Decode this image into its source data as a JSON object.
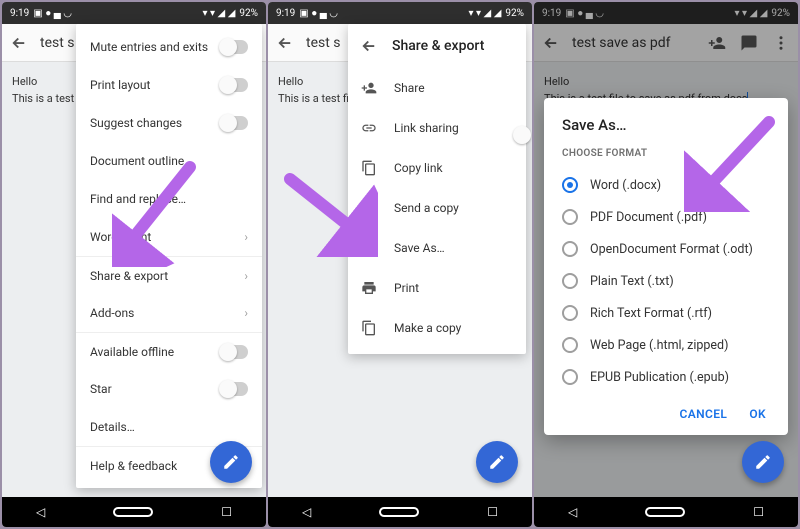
{
  "status": {
    "time": "9:19",
    "battery": "92%"
  },
  "doc": {
    "title_short": "test s",
    "title_full": "test save as pdf",
    "line1": "Hello",
    "line2_short": "This is a test fi",
    "line2_full": "This is a test file to save as pdf from docs"
  },
  "menu_items": [
    {
      "label": "Mute entries and exits",
      "type": "toggle"
    },
    {
      "label": "Print layout",
      "type": "toggle"
    },
    {
      "label": "Suggest changes",
      "type": "toggle"
    },
    {
      "label": "Document outline",
      "type": "plain"
    },
    {
      "label": "Find and replace…",
      "type": "plain"
    },
    {
      "label": "Word count",
      "type": "chevron"
    },
    {
      "label": "Share & export",
      "type": "chevron",
      "sep": true
    },
    {
      "label": "Add-ons",
      "type": "chevron"
    },
    {
      "label": "Available offline",
      "type": "toggle",
      "sep": true
    },
    {
      "label": "Star",
      "type": "toggle"
    },
    {
      "label": "Details…",
      "type": "plain"
    },
    {
      "label": "Help & feedback",
      "type": "plain",
      "sep": true
    }
  ],
  "share_panel": {
    "title": "Share & export",
    "items": [
      {
        "label": "Share",
        "icon": "person-add"
      },
      {
        "label": "Link sharing",
        "icon": "link",
        "toggle": true
      },
      {
        "label": "Copy link",
        "icon": "copy"
      },
      {
        "label": "Send a copy",
        "icon": "send"
      },
      {
        "label": "Save As…",
        "icon": "save"
      },
      {
        "label": "Print",
        "icon": "print"
      },
      {
        "label": "Make a copy",
        "icon": "file-copy"
      }
    ]
  },
  "dialog": {
    "title": "Save As…",
    "subhead": "CHOOSE FORMAT",
    "options": [
      "Word (.docx)",
      "PDF Document (.pdf)",
      "OpenDocument Format (.odt)",
      "Plain Text (.txt)",
      "Rich Text Format (.rtf)",
      "Web Page (.html, zipped)",
      "EPUB Publication (.epub)"
    ],
    "selected": 0,
    "cancel": "CANCEL",
    "ok": "OK"
  },
  "arrow_color": "#b466e8"
}
